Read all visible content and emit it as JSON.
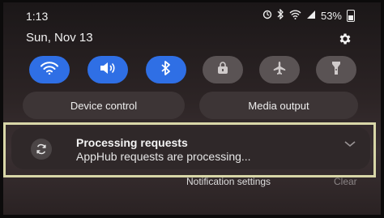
{
  "status_bar": {
    "time": "1:13",
    "battery": "53%"
  },
  "header": {
    "date": "Sun, Nov 13"
  },
  "quick_settings": {
    "toggles": [
      {
        "name": "wifi",
        "state": "on"
      },
      {
        "name": "sound",
        "state": "on"
      },
      {
        "name": "bluetooth",
        "state": "on"
      },
      {
        "name": "lock",
        "state": "off"
      },
      {
        "name": "airplane",
        "state": "off"
      },
      {
        "name": "flashlight",
        "state": "off"
      }
    ],
    "device_control_label": "Device control",
    "media_output_label": "Media output"
  },
  "notification": {
    "title": "Processing requests",
    "body": "AppHub requests are processing..."
  },
  "footer": {
    "settings_label": "Notification settings",
    "clear_label": "Clear"
  },
  "colors": {
    "toggle_on": "#2f6fe5",
    "toggle_off": "#5a5354",
    "highlight": "#d9d7a8"
  }
}
